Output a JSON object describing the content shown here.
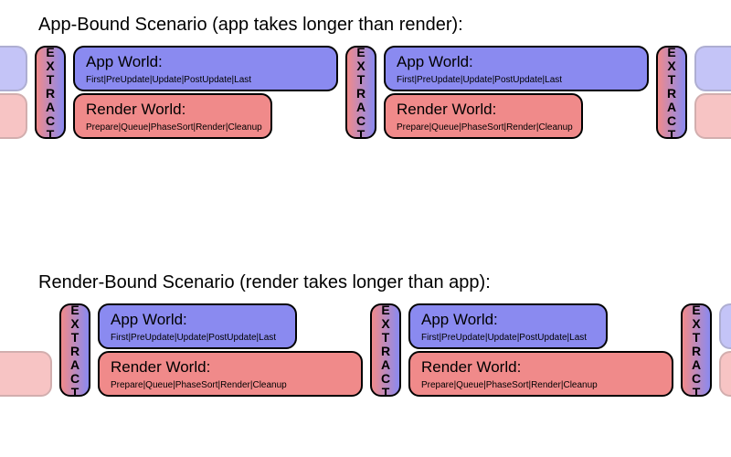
{
  "scenario1": {
    "title": "App-Bound Scenario (app takes longer than render):"
  },
  "scenario2": {
    "title": "Render-Bound Scenario (render takes longer than app):"
  },
  "extract_label": "EXTRACT",
  "app_world": {
    "title": "App World:",
    "phases": "First|PreUpdate|Update|PostUpdate|Last"
  },
  "render_world": {
    "title": "Render World:",
    "phases": "Prepare|Queue|PhaseSort|Render|Cleanup"
  }
}
